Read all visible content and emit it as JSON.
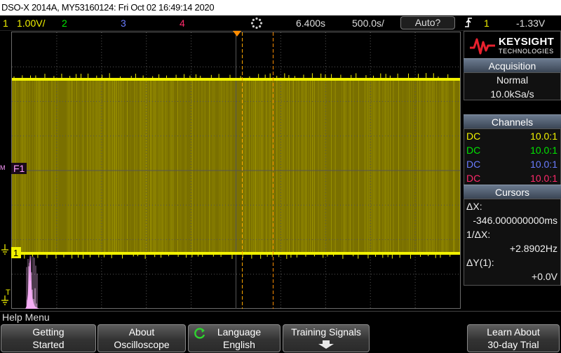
{
  "title_bar": "DSO-X 2014A, MY53160124: Fri Oct 02 16:49:14 2020",
  "status": {
    "ch1_num": "1",
    "ch1_scale": "1.00V/",
    "ch2_num": "2",
    "ch3_num": "3",
    "ch4_num": "4",
    "time_delay": "6.400s",
    "time_scale": "500.0s/",
    "trigger_mode": "Auto?",
    "trigger_channel": "1",
    "trigger_level": "-1.33V"
  },
  "markers": {
    "ground_label": "1",
    "math_label": "F1",
    "trigger_marker": "T"
  },
  "logo": {
    "brand": "KEYSIGHT",
    "tagline": "TECHNOLOGIES"
  },
  "acquisition": {
    "header": "Acquisition",
    "mode": "Normal",
    "rate": "10.0kSa/s"
  },
  "channels": {
    "header": "Channels",
    "rows": [
      {
        "coupling": "DC",
        "probe": "10.0:1",
        "color": "#f2f200"
      },
      {
        "coupling": "DC",
        "probe": "10.0:1",
        "color": "#00e600"
      },
      {
        "coupling": "DC",
        "probe": "10.0:1",
        "color": "#6a7cff"
      },
      {
        "coupling": "DC",
        "probe": "10.0:1",
        "color": "#ff2a6a"
      }
    ]
  },
  "cursors": {
    "header": "Cursors",
    "dx_label": "ΔX:",
    "dx_value": "-346.000000000ms",
    "inv_dx_label": "1/ΔX:",
    "inv_dx_value": "+2.8902Hz",
    "dy_label": "ΔY(1):",
    "dy_value": "+0.0V"
  },
  "help_bar": "Help Menu",
  "softkeys": [
    {
      "line1": "Getting",
      "line2": "Started"
    },
    {
      "line1": "About",
      "line2": "Oscilloscope"
    },
    {
      "line1": "Language",
      "line2": "English"
    },
    {
      "line1": "Training Signals",
      "line2": ""
    },
    {
      "line1": "Learn About",
      "line2": "30-day Trial"
    }
  ],
  "colors": {
    "ch1": "#f2f200",
    "ch2": "#00e600",
    "ch3": "#6a7cff",
    "ch4": "#ff2a6a",
    "math": "#ff9bff",
    "trigger_marker": "#ff8c00",
    "cursor": "#ffa500",
    "fill": "#7a7000"
  }
}
